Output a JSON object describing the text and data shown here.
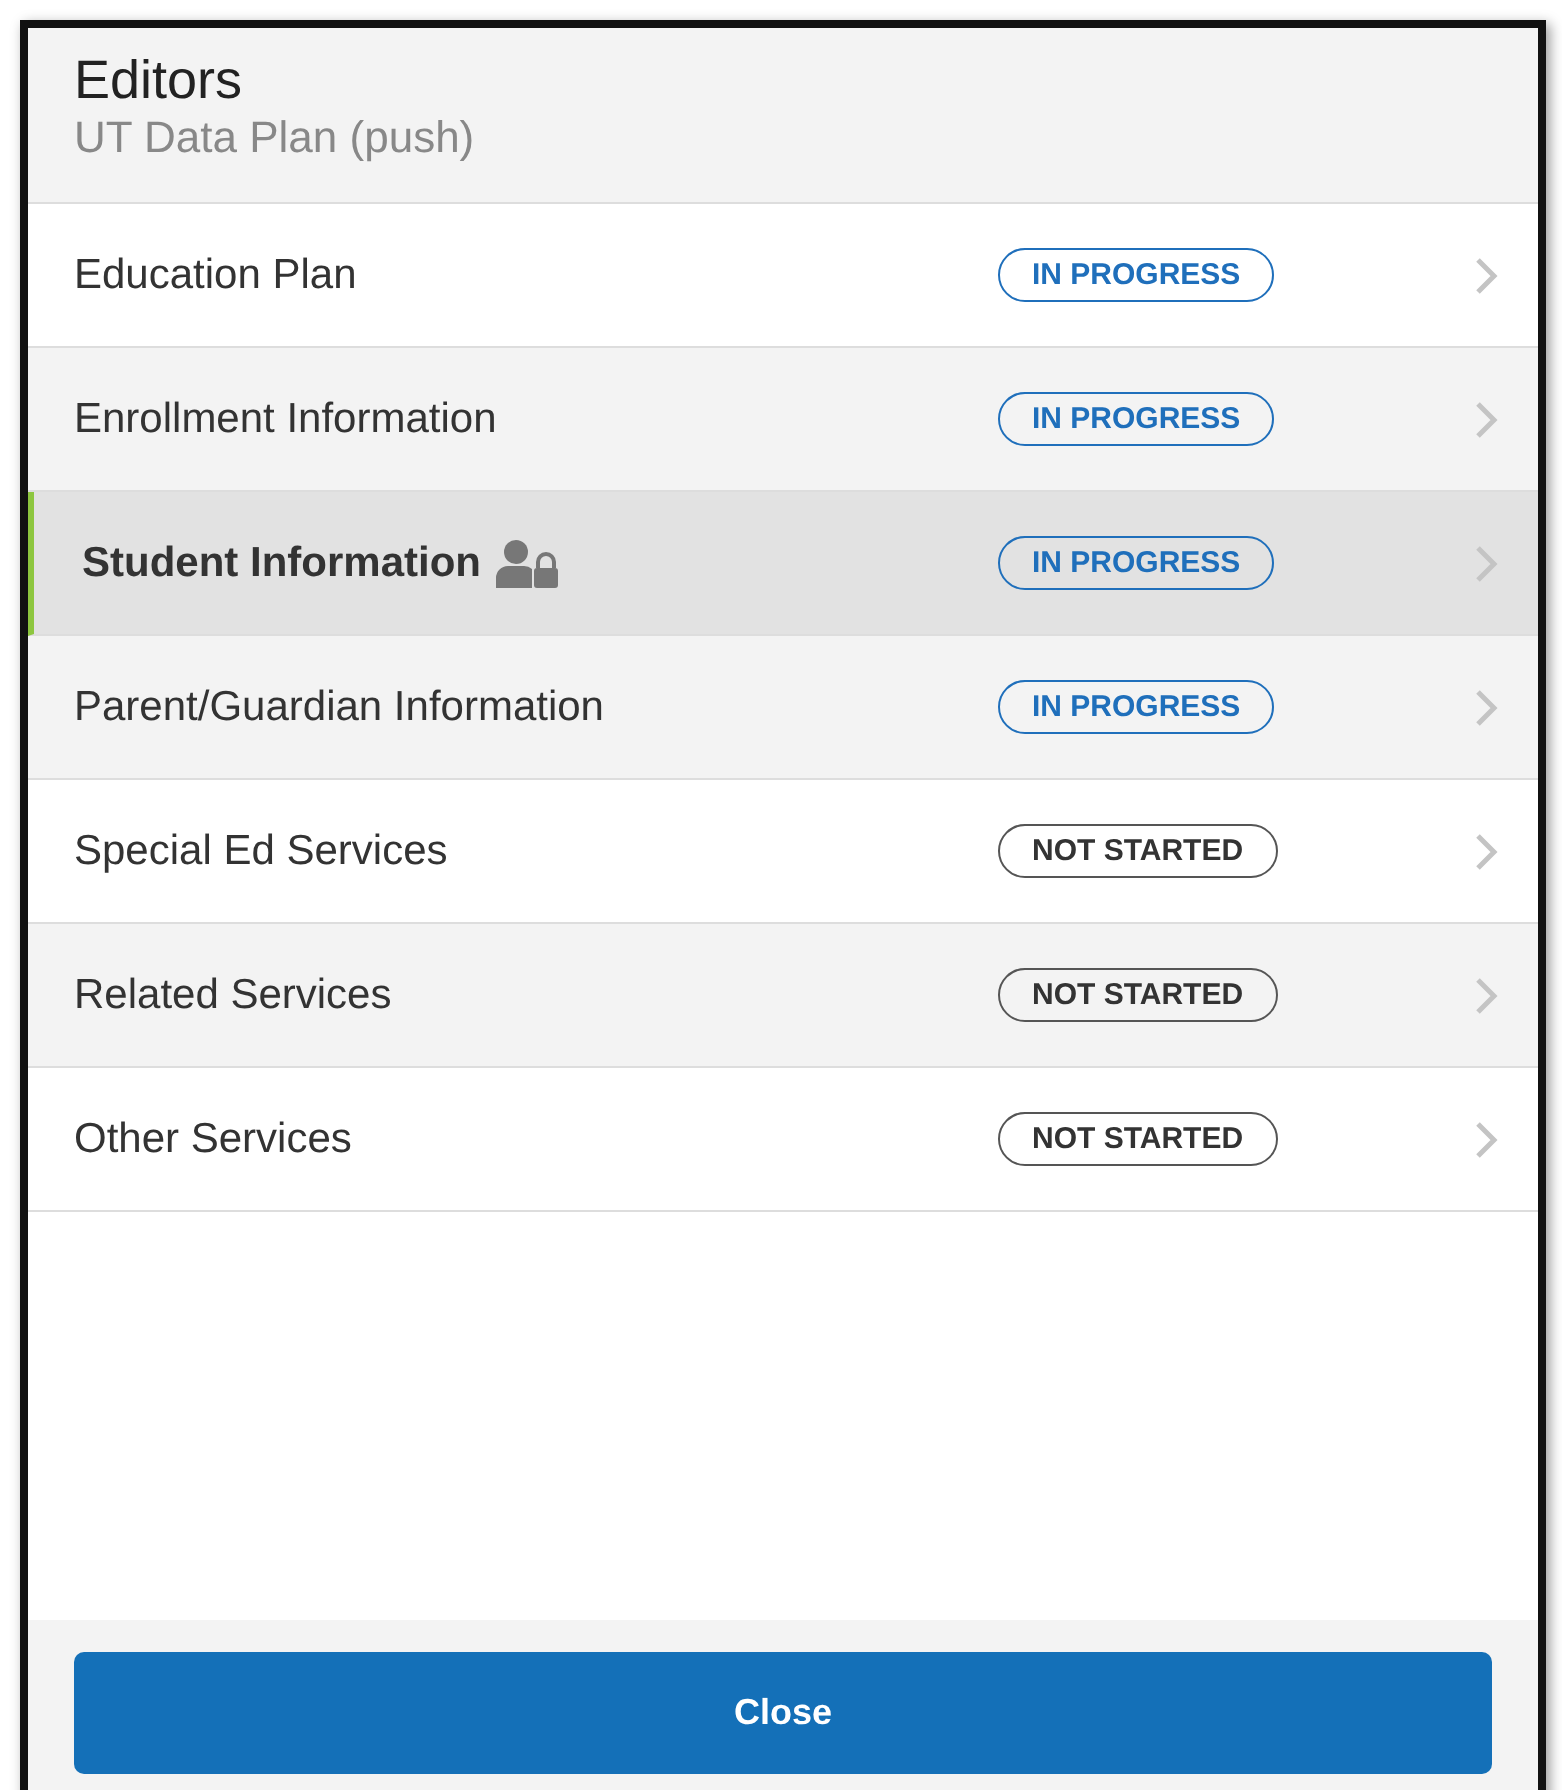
{
  "header": {
    "title": "Editors",
    "subtitle": "UT Data Plan (push)"
  },
  "editors": [
    {
      "label": "Education Plan",
      "status": "IN PROGRESS",
      "kind": "in_progress",
      "selected": false,
      "locked": false
    },
    {
      "label": "Enrollment Information",
      "status": "IN PROGRESS",
      "kind": "in_progress",
      "selected": false,
      "locked": false
    },
    {
      "label": "Student Information",
      "status": "IN PROGRESS",
      "kind": "in_progress",
      "selected": true,
      "locked": true
    },
    {
      "label": "Parent/Guardian Information",
      "status": "IN PROGRESS",
      "kind": "in_progress",
      "selected": false,
      "locked": false
    },
    {
      "label": "Special Ed Services",
      "status": "NOT STARTED",
      "kind": "not_started",
      "selected": false,
      "locked": false
    },
    {
      "label": "Related Services",
      "status": "NOT STARTED",
      "kind": "not_started",
      "selected": false,
      "locked": false
    },
    {
      "label": "Other Services",
      "status": "NOT STARTED",
      "kind": "not_started",
      "selected": false,
      "locked": false
    }
  ],
  "footer": {
    "button": "Close"
  }
}
